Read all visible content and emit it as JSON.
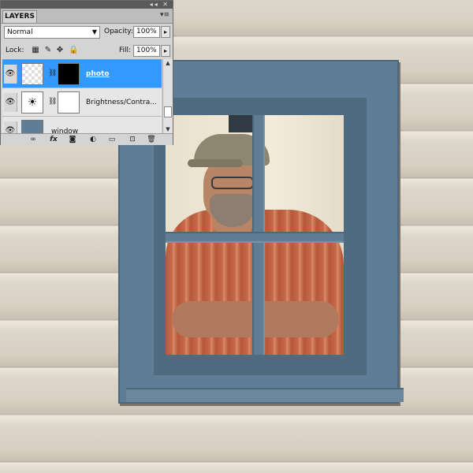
{
  "panel": {
    "title": "LAYERS",
    "titlebar_icons": "◂◂ ✕",
    "menu_icon": "▾≡",
    "blend_mode": "Normal",
    "opacity_label": "Opacity:",
    "opacity_value": "100%",
    "lock_label": "Lock:",
    "fill_label": "Fill:",
    "fill_value": "100%",
    "flyout_arrow": "▸",
    "layers": [
      {
        "name": "photo",
        "visible": true,
        "selected": true
      },
      {
        "name": "Brightness/Contra...",
        "visible": true,
        "selected": false
      },
      {
        "name": "window",
        "visible": true,
        "selected": false
      }
    ],
    "icons": {
      "eye": "👁",
      "chain": "⛓",
      "lock_transparent": "▦",
      "lock_image": "✎",
      "lock_position": "✥",
      "lock_all": "🔒",
      "link": "∞",
      "fx": "fx",
      "mask": "◙",
      "adjustment": "◐",
      "group": "▭",
      "new_layer": "⊡",
      "delete": "🗑",
      "brightness": "☀"
    }
  },
  "colors": {
    "selection": "#3399ff",
    "window_frame": "#5f7d94",
    "siding": "#ddd6ca"
  }
}
